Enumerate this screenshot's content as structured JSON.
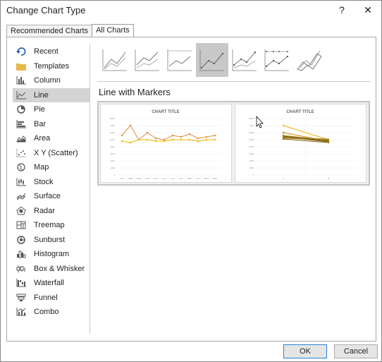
{
  "window": {
    "title": "Change Chart Type",
    "help": "?",
    "close": "✕"
  },
  "tabs": [
    {
      "label": "Recommended Charts"
    },
    {
      "label": "All Charts"
    }
  ],
  "sidebar": {
    "items": [
      {
        "label": "Recent",
        "icon": "recent-icon"
      },
      {
        "label": "Templates",
        "icon": "folder-icon"
      },
      {
        "label": "Column",
        "icon": "column-chart-icon"
      },
      {
        "label": "Line",
        "icon": "line-chart-icon"
      },
      {
        "label": "Pie",
        "icon": "pie-chart-icon"
      },
      {
        "label": "Bar",
        "icon": "bar-chart-icon"
      },
      {
        "label": "Area",
        "icon": "area-chart-icon"
      },
      {
        "label": "X Y (Scatter)",
        "icon": "scatter-chart-icon"
      },
      {
        "label": "Map",
        "icon": "map-icon"
      },
      {
        "label": "Stock",
        "icon": "stock-chart-icon"
      },
      {
        "label": "Surface",
        "icon": "surface-chart-icon"
      },
      {
        "label": "Radar",
        "icon": "radar-chart-icon"
      },
      {
        "label": "Treemap",
        "icon": "treemap-icon"
      },
      {
        "label": "Sunburst",
        "icon": "sunburst-icon"
      },
      {
        "label": "Histogram",
        "icon": "histogram-icon"
      },
      {
        "label": "Box & Whisker",
        "icon": "box-whisker-icon"
      },
      {
        "label": "Waterfall",
        "icon": "waterfall-icon"
      },
      {
        "label": "Funnel",
        "icon": "funnel-icon"
      },
      {
        "label": "Combo",
        "icon": "combo-chart-icon"
      }
    ],
    "selected": "Line"
  },
  "subtypes_selected": "Line with Markers",
  "section_title": "Line with Markers",
  "preview1": {
    "title": "CHART TITLE",
    "yticks": [
      "8000",
      "7000",
      "6000",
      "5000",
      "4000",
      "3000",
      "2000",
      "1000",
      "0"
    ],
    "xticks": [
      "JAN",
      "FEB",
      "MAR",
      "APR",
      "MAY",
      "JUN",
      "JUL",
      "AUG",
      "SEP",
      "OCT",
      "NOV",
      "DEC"
    ]
  },
  "preview2": {
    "title": "CHART TITLE",
    "yticks": [
      "8000",
      "7000",
      "6000",
      "5000",
      "4000",
      "3000",
      "2000",
      "1000",
      "0"
    ],
    "xticks": [
      "A",
      "B"
    ]
  },
  "buttons": {
    "ok": "OK",
    "cancel": "Cancel"
  },
  "colors": {
    "selected_bg": "#d4d4d4",
    "series1": "#e58b3a",
    "series2": "#f0b400",
    "accent_border": "#2a7fd4"
  }
}
